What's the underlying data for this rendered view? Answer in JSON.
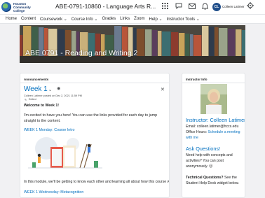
{
  "header": {
    "logo_text": [
      "Houston",
      "Community",
      "College"
    ],
    "course_title": "ABE-0791-10860 - Language Arts R...",
    "icons": [
      "grid-icon",
      "chat-icon",
      "mail-icon",
      "bell-icon"
    ],
    "user_initials": "CL",
    "user_name": "Colleen Latimer",
    "settings_icon": "gear-icon"
  },
  "nav": {
    "items": [
      "Home",
      "Content",
      "Coursework ⌄",
      "Course Info ⌄",
      "Grades",
      "Links",
      "Zoom",
      "Help ⌄",
      "Instructor Tools ⌄"
    ]
  },
  "banner": {
    "title": "ABE 0791 - Reading and Writing 2"
  },
  "announcements": {
    "widget_title": "Announcements",
    "week_title": "Week 1",
    "posted": "Colleen Latimer posted on Dec 2, 2021 11:59 PM",
    "edited": "Edited",
    "welcome": "Welcome to Week 1!",
    "intro": "I'm excited to have you here! You can use the links provided for each day to jump straight to the content.",
    "link1": "WEEK 1 Monday: Course Intro",
    "module_text": "In this module, we'll be getting to know each other and learning all about how this course works.",
    "link2": "WEEK 1 Wednesday: Metacognition"
  },
  "instructor": {
    "widget_title": "Instructor Info",
    "name": "Instructor: Colleen Latimer",
    "email": "Email: colleen.latimer@hccs.edu",
    "office_prefix": "Office Hours: ",
    "office_link": "Schedule a meeting",
    "office_suffix": "with me",
    "ask_title": "Ask Questions!",
    "ask_text": "Need help with concepts and activities? You can post anonymously. 😊",
    "tech_label": "Technical Questions?",
    "tech_text": " See the Student Help Desk widget below."
  },
  "colors": {
    "link": "#006fbf",
    "text": "#202122",
    "background": "#f1f1f3"
  }
}
